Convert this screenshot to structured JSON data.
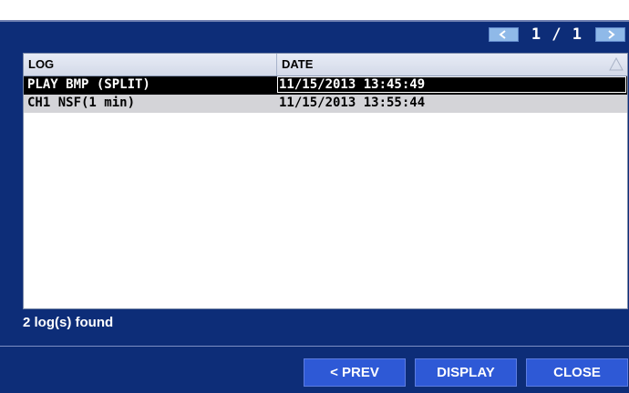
{
  "pager": {
    "page_text": "1 / 1"
  },
  "table": {
    "headers": [
      "LOG",
      "DATE"
    ],
    "rows": [
      {
        "log": "PLAY BMP (SPLIT)",
        "date": "11/15/2013 13:45:49"
      },
      {
        "log": "CH1 NSF(1 min)",
        "date": "11/15/2013 13:55:44"
      }
    ]
  },
  "status": {
    "text": "2 log(s) found"
  },
  "buttons": {
    "prev_label": "< PREV",
    "display_label": "DISPLAY",
    "close_label": "CLOSE"
  },
  "colors": {
    "background": "#0d2d78",
    "button": "#2e59d6",
    "pager_button": "#8fb9e8",
    "selected_row": "#000000"
  },
  "icons": {
    "prev_page": "arrow-left-icon",
    "next_page": "arrow-right-icon",
    "sort": "sort-up-triangle-icon"
  }
}
